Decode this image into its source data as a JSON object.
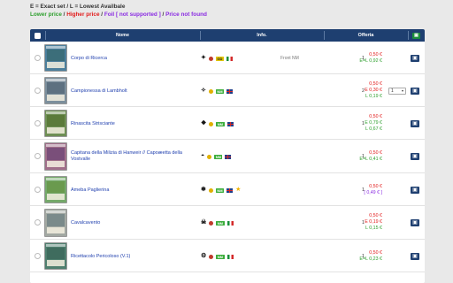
{
  "legend": {
    "line1": "E = Exact set / L = Lowest Availbale",
    "lower_price": "Lower price",
    "sep1": " / ",
    "higher_price": "Higher price",
    "sep2": " / ",
    "foil_not_supported": "Foil [ not supported ]",
    "sep3": " / ",
    "price_not_found": "Price not found"
  },
  "table": {
    "headers": {
      "name": "Nome",
      "info": "Info.",
      "offer": "Offerta"
    },
    "rows": [
      {
        "name": "Corpo di Ricerca",
        "icons": [
          "set-symbol",
          "rarity-dot-red",
          "condition-gd",
          "flag-it"
        ],
        "condition": "GD",
        "note": "Front NM",
        "prices": [
          {
            "text": "0,50 €",
            "cls": "p-red"
          },
          {
            "text": "E=L 0,92 €",
            "cls": "p-green"
          }
        ],
        "qty": "1",
        "select": ""
      },
      {
        "name": "Campionessa di Lambholt",
        "icons": [
          "set-symbol",
          "rarity-dot-gold",
          "condition-nm",
          "flag-uk"
        ],
        "condition": "NM",
        "note": "",
        "prices": [
          {
            "text": "0,50 €",
            "cls": "p-red"
          },
          {
            "text": "E 0,30 €",
            "cls": "p-red"
          },
          {
            "text": "L 0,19 €",
            "cls": "p-green"
          }
        ],
        "qty": "2",
        "select": "1"
      },
      {
        "name": "Rinascita Strisciante",
        "icons": [
          "set-symbol",
          "rarity-dot-gold",
          "condition-nm",
          "flag-uk"
        ],
        "condition": "NM",
        "note": "",
        "prices": [
          {
            "text": "0,50 €",
            "cls": "p-red"
          },
          {
            "text": "E 0,79 €",
            "cls": "p-green"
          },
          {
            "text": "L 0,67 €",
            "cls": "p-green"
          }
        ],
        "qty": "1",
        "select": ""
      },
      {
        "name": "Capitana della Milizia di Hanweir // Capoæetta della Vostvalle",
        "icons": [
          "set-symbol",
          "rarity-dot-gold",
          "condition-nm",
          "flag-uk"
        ],
        "condition": "NM",
        "note": "",
        "prices": [
          {
            "text": "0,50 €",
            "cls": "p-red"
          },
          {
            "text": "E=L 0,41 €",
            "cls": "p-green"
          }
        ],
        "qty": "1",
        "select": ""
      },
      {
        "name": "Ameba Paglierina",
        "icons": [
          "set-symbol",
          "rarity-dot-gold",
          "condition-nm",
          "flag-uk",
          "foil-star"
        ],
        "condition": "NM",
        "note": "",
        "prices": [
          {
            "text": "0,50 €",
            "cls": "p-red"
          },
          {
            "text": "[ 0,49 € ]",
            "cls": "p-purple"
          }
        ],
        "qty": "1",
        "select": ""
      },
      {
        "name": "Cavalcavento",
        "icons": [
          "set-symbol",
          "rarity-dot-red",
          "condition-nm",
          "flag-it"
        ],
        "condition": "NM",
        "note": "",
        "prices": [
          {
            "text": "0,50 €",
            "cls": "p-red"
          },
          {
            "text": "E 0,19 €",
            "cls": "p-red"
          },
          {
            "text": "L 0,15 €",
            "cls": "p-green"
          }
        ],
        "qty": "1",
        "select": ""
      },
      {
        "name": "Ricettacolo Pericoloso (V.1)",
        "icons": [
          "set-symbol",
          "rarity-dot-red",
          "condition-nm",
          "flag-it"
        ],
        "condition": "NM",
        "note": "",
        "prices": [
          {
            "text": "0,50 €",
            "cls": "p-red"
          },
          {
            "text": "E=L 0,23 €",
            "cls": "p-green"
          }
        ],
        "qty": "1",
        "select": ""
      }
    ]
  },
  "colors": {
    "header_bg": "#1e3f70",
    "lower": "#2e9f2e",
    "higher": "#e21b1b",
    "foil": "#8a2be2"
  }
}
